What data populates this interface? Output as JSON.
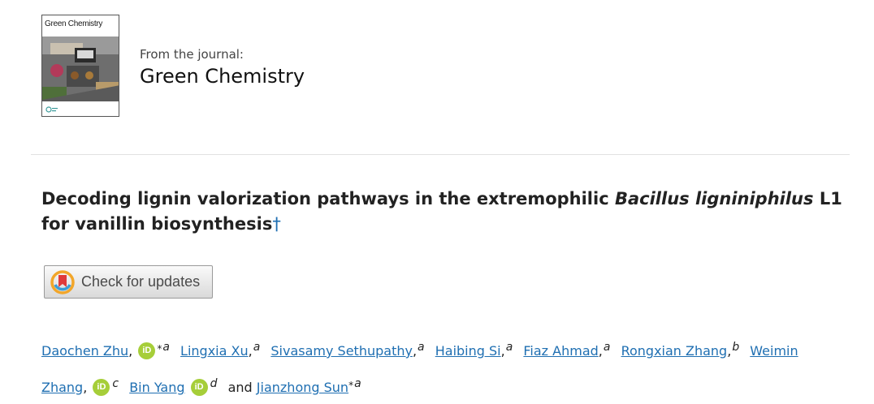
{
  "journal": {
    "cover_title": "Green Chemistry",
    "from_label": "From the journal:",
    "name": "Green Chemistry"
  },
  "article": {
    "title_part1": "Decoding lignin valorization pathways in the extremophilic ",
    "title_italic": "Bacillus ligniniphilus",
    "title_part2": " L1 for vanillin biosynthesis",
    "title_dagger": "†"
  },
  "updates_button": {
    "label": "Check for updates"
  },
  "authors": [
    {
      "name": "Daochen Zhu",
      "orcid": true,
      "corresponding": true,
      "affil": "a"
    },
    {
      "name": "Lingxia Xu",
      "orcid": false,
      "corresponding": false,
      "affil": "a"
    },
    {
      "name": "Sivasamy Sethupathy",
      "orcid": false,
      "corresponding": false,
      "affil": "a"
    },
    {
      "name": "Haibing Si",
      "orcid": false,
      "corresponding": false,
      "affil": "a"
    },
    {
      "name": "Fiaz Ahmad",
      "orcid": false,
      "corresponding": false,
      "affil": "a"
    },
    {
      "name": "Rongxian Zhang",
      "orcid": false,
      "corresponding": false,
      "affil": "b"
    },
    {
      "name": "Weimin Zhang",
      "orcid": true,
      "corresponding": false,
      "affil": "c"
    },
    {
      "name": "Bin Yang",
      "orcid": true,
      "corresponding": false,
      "affil": "d"
    },
    {
      "name": "Jianzhong Sun",
      "orcid": false,
      "corresponding": true,
      "affil": "a"
    }
  ],
  "authors_conjunction": "and",
  "orcid_label": "iD",
  "corresponding_mark": "*",
  "colors": {
    "link": "#1f6fb2",
    "orcid": "#a6ce39"
  }
}
